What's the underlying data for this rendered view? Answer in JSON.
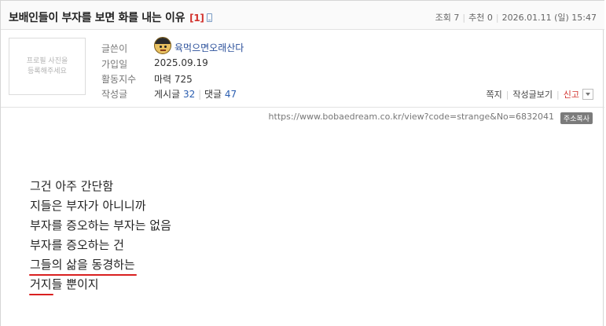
{
  "post": {
    "title": "보배인들이 부자를 보면 화를 내는 이유",
    "comment_count": "[1]",
    "meta": {
      "views_label": "조회 7",
      "recommend_label": "추천 0",
      "date": "2026.01.11 (일) 15:47"
    }
  },
  "author": {
    "profile_placeholder": "프로필 사진을\n등록해주세요",
    "labels": {
      "writer": "글쓴이",
      "joined": "가입일",
      "activity": "활동지수",
      "posts": "작성글"
    },
    "nickname": "육먹으면오래산다",
    "joined_date": "2025.09.19",
    "activity_value": "마력 725",
    "posts_label": "게시글",
    "posts_count": "32",
    "comments_label": "댓글",
    "comments_count": "47"
  },
  "actions": {
    "message": "쪽지",
    "view_posts": "작성글보기",
    "report": "신고"
  },
  "url": {
    "text": "https://www.bobaedream.co.kr/view?code=strange&No=6832041",
    "copy_label": "주소복사"
  },
  "content": {
    "line1": "그건 아주 간단함",
    "line2": "지들은 부자가 아니니까",
    "line3": "부자를 증오하는 부자는 없음",
    "line4": "부자를 증오하는 건",
    "line5": "그들의 삶을 동경하는",
    "line6_underlined": "거지",
    "line6_rest": "들 뿐이지"
  },
  "colors": {
    "accent_red": "#d92020",
    "link_blue": "#2a5db0"
  }
}
